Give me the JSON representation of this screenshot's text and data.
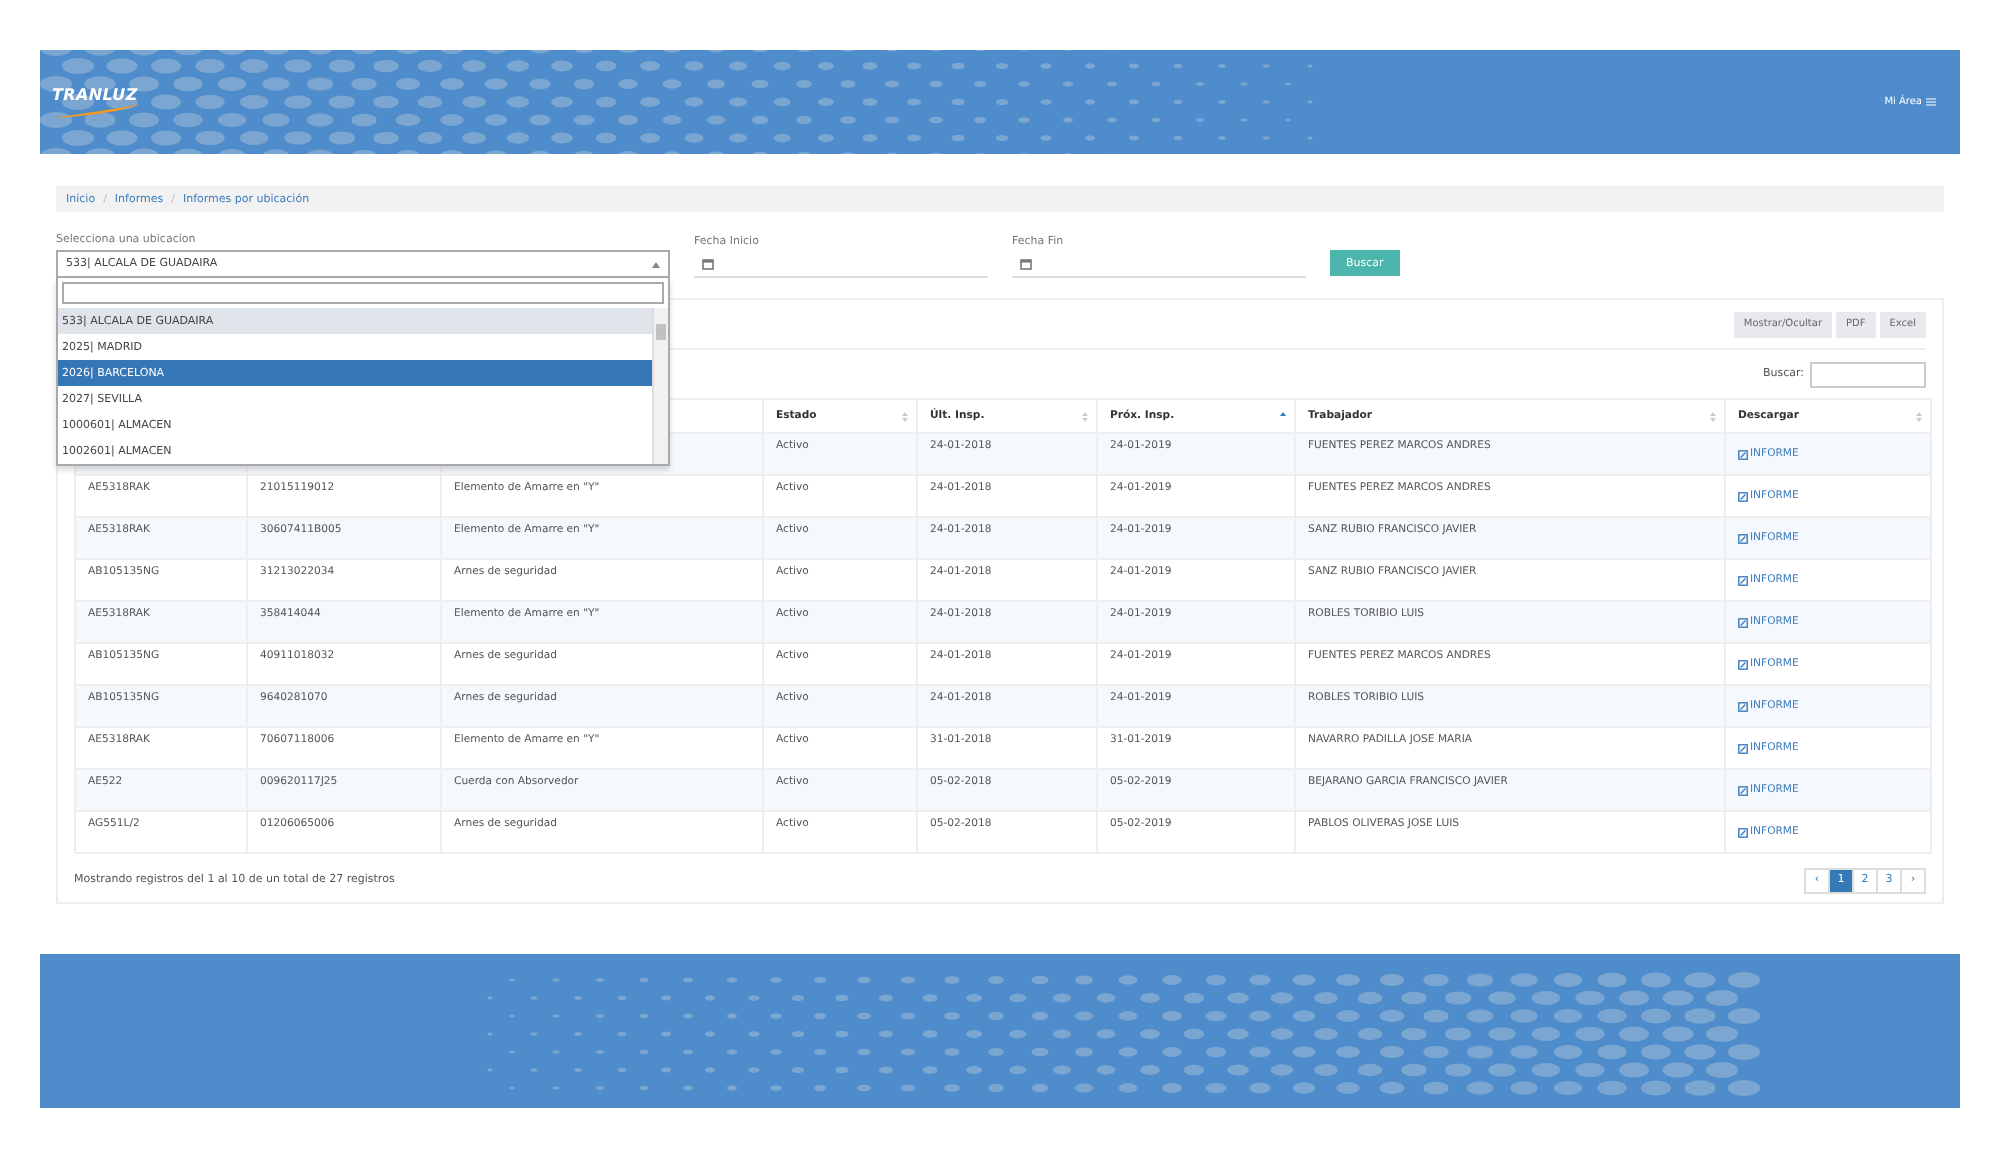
{
  "header": {
    "logo": "TRANLUZ",
    "user_menu": "Mi Área"
  },
  "breadcrumb": {
    "separator": "/",
    "items": [
      {
        "label": "Inicio"
      },
      {
        "label": "Informes"
      },
      {
        "label": "Informes por ubicación"
      }
    ]
  },
  "filters": {
    "location": {
      "label": "Selecciona una ubicacion",
      "value": "533| ALCALA DE GUADAIRA",
      "expanded": true,
      "options": [
        {
          "label": "533| ALCALA DE GUADAIRA",
          "selected": true,
          "highlighted": false
        },
        {
          "label": "2025| MADRID",
          "selected": false,
          "highlighted": false
        },
        {
          "label": "2026| BARCELONA",
          "selected": false,
          "highlighted": true
        },
        {
          "label": "2027| SEVILLA",
          "selected": false,
          "highlighted": false
        },
        {
          "label": "1000601| ALMACEN",
          "selected": false,
          "highlighted": false
        },
        {
          "label": "1002601| ALMACEN",
          "selected": false,
          "highlighted": false
        }
      ]
    },
    "start_date": {
      "label": "Fecha Inicio"
    },
    "end_date": {
      "label": "Fecha Fin"
    },
    "search_button": "Buscar"
  },
  "toolbar": [
    "Mostrar/Ocultar",
    "PDF",
    "Excel"
  ],
  "table_search": {
    "label": "Buscar:"
  },
  "table": {
    "columns": [
      {},
      {},
      {},
      {
        "label": "Estado",
        "sorted": false
      },
      {
        "label": "Últ. Insp.",
        "sorted": false
      },
      {
        "label": "Próx. Insp.",
        "sorted": true
      },
      {
        "label": "Trabajador",
        "sorted": false
      },
      {
        "label": "Descargar",
        "sorted": false
      }
    ],
    "rows": [
      {
        "status": "Activo",
        "last": "24-01-2018",
        "next": "24-01-2019",
        "worker": "FUENTES PEREZ MARCOS ANDRES",
        "download": "INFORME"
      },
      {
        "model": "AE5318RAK",
        "serial": "21015119012",
        "type": "Elemento de Amarre en \"Y\"",
        "status": "Activo",
        "last": "24-01-2018",
        "next": "24-01-2019",
        "worker": "FUENTES PEREZ MARCOS ANDRES",
        "download": "INFORME"
      },
      {
        "model": "AE5318RAK",
        "serial": "30607411B005",
        "type": "Elemento de Amarre en \"Y\"",
        "status": "Activo",
        "last": "24-01-2018",
        "next": "24-01-2019",
        "worker": "SANZ RUBIO FRANCISCO JAVIER",
        "download": "INFORME"
      },
      {
        "model": "AB105135NG",
        "serial": "31213022034",
        "type": "Arnes de seguridad",
        "status": "Activo",
        "last": "24-01-2018",
        "next": "24-01-2019",
        "worker": "SANZ RUBIO FRANCISCO JAVIER",
        "download": "INFORME"
      },
      {
        "model": "AE5318RAK",
        "serial": "358414044",
        "type": "Elemento de Amarre en \"Y\"",
        "status": "Activo",
        "last": "24-01-2018",
        "next": "24-01-2019",
        "worker": "ROBLES TORIBIO LUIS",
        "download": "INFORME"
      },
      {
        "model": "AB105135NG",
        "serial": "40911018032",
        "type": "Arnes de seguridad",
        "status": "Activo",
        "last": "24-01-2018",
        "next": "24-01-2019",
        "worker": "FUENTES PEREZ MARCOS ANDRES",
        "download": "INFORME"
      },
      {
        "model": "AB105135NG",
        "serial": "9640281070",
        "type": "Arnes de seguridad",
        "status": "Activo",
        "last": "24-01-2018",
        "next": "24-01-2019",
        "worker": "ROBLES TORIBIO LUIS",
        "download": "INFORME"
      },
      {
        "model": "AE5318RAK",
        "serial": "70607118006",
        "type": "Elemento de Amarre en \"Y\"",
        "status": "Activo",
        "last": "31-01-2018",
        "next": "31-01-2019",
        "worker": "NAVARRO PADILLA JOSE MARIA",
        "download": "INFORME"
      },
      {
        "model": "AE522",
        "serial": "009620117J25",
        "type": "Cuerda con Absorvedor",
        "status": "Activo",
        "last": "05-02-2018",
        "next": "05-02-2019",
        "worker": "BEJARANO GARCIA FRANCISCO JAVIER",
        "download": "INFORME"
      },
      {
        "model": "AG551L/2",
        "serial": "01206065006",
        "type": "Arnes de seguridad",
        "status": "Activo",
        "last": "05-02-2018",
        "next": "05-02-2019",
        "worker": "PABLOS OLIVERAS JOSE LUIS",
        "download": "INFORME"
      }
    ]
  },
  "summary": "Mostrando registros del 1 al 10 de un total de 27 registros",
  "pagination": {
    "previous": "‹",
    "next": "›",
    "pages": [
      {
        "label": "1",
        "selected": true
      },
      {
        "label": "2",
        "selected": false
      },
      {
        "label": "3",
        "selected": false
      }
    ]
  }
}
